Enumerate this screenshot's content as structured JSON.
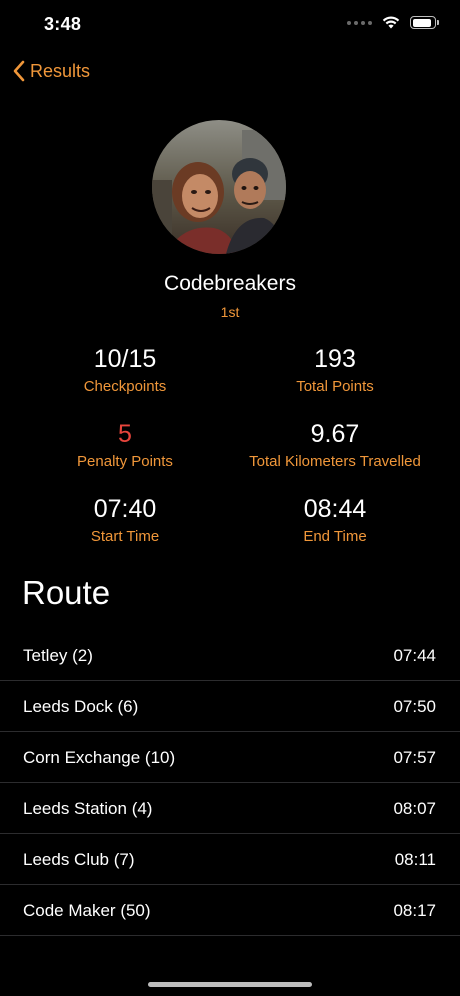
{
  "status_bar": {
    "time": "3:48",
    "icons": [
      "cellular-signal-icon",
      "wifi-icon",
      "battery-icon"
    ]
  },
  "nav": {
    "back_label": "Results",
    "back_icon": "chevron-left-icon"
  },
  "team": {
    "name": "Codebreakers",
    "rank": "1st",
    "avatar_icon": "team-photo"
  },
  "stats": {
    "checkpoints_value": "10/15",
    "checkpoints_label": "Checkpoints",
    "total_points_value": "193",
    "total_points_label": "Total Points",
    "penalty_value": "5",
    "penalty_label": "Penalty Points",
    "distance_value": "9.67",
    "distance_label": "Total Kilometers Travelled",
    "start_value": "07:40",
    "start_label": "Start Time",
    "end_value": "08:44",
    "end_label": "End Time"
  },
  "route": {
    "title": "Route",
    "items": [
      {
        "name": "Tetley (2)",
        "time": "07:44"
      },
      {
        "name": "Leeds Dock (6)",
        "time": "07:50"
      },
      {
        "name": "Corn Exchange (10)",
        "time": "07:57"
      },
      {
        "name": "Leeds Station (4)",
        "time": "08:07"
      },
      {
        "name": "Leeds Club (7)",
        "time": "08:11"
      },
      {
        "name": "Code Maker (50)",
        "time": "08:17"
      }
    ]
  },
  "colors": {
    "background": "#000000",
    "accent": "#f0973a",
    "penalty": "#e8453c",
    "text": "#ffffff",
    "divider": "#2c2c2e"
  }
}
